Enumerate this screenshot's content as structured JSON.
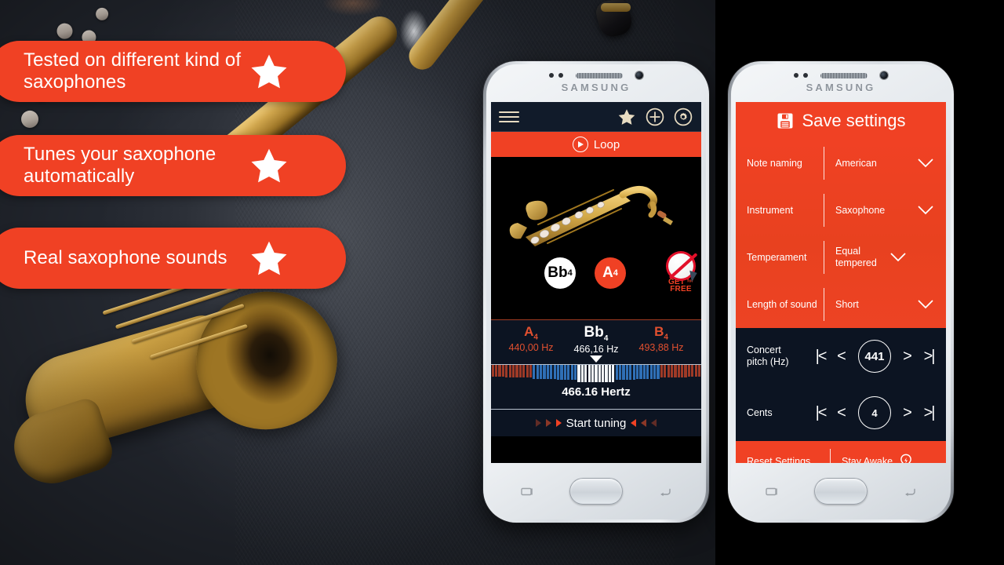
{
  "brand": {
    "name": "SAMSUNG"
  },
  "theme": {
    "accent": "#f04124",
    "app_dark": "#0c1422",
    "header_dark": "#111b2a",
    "icon_cream": "#e8dcc2",
    "white": "#ffffff"
  },
  "features": [
    {
      "text": "Tested on different kind of saxophones",
      "icon": "star-icon"
    },
    {
      "text": "Tunes your saxophone automatically",
      "icon": "star-icon"
    },
    {
      "text": "Real saxophone sounds",
      "icon": "star-icon"
    }
  ],
  "phone_tuner": {
    "header": {
      "menu_icon": "hamburger-icon",
      "favorite_icon": "star-icon",
      "add_icon": "plus-circle-icon",
      "settings_icon": "gear-icon"
    },
    "loop_button": {
      "label": "Loop",
      "icon": "play-circle-icon"
    },
    "instrument_image": "saxophone-illustration",
    "note_chips": [
      {
        "note": "Bb",
        "octave": "4",
        "style": "white"
      },
      {
        "note": "A",
        "octave": "4",
        "style": "orange"
      }
    ],
    "promo_badge": {
      "line1": "GET",
      "middle": "for",
      "line2": "FREE",
      "icon": "no-ads-icon"
    },
    "frequencies": [
      {
        "note": "A",
        "octave": "4",
        "hz": "440,00 Hz",
        "active": false
      },
      {
        "note": "Bb",
        "octave": "4",
        "hz": "466,16 Hz",
        "active": true
      },
      {
        "note": "B",
        "octave": "4",
        "hz": "493,88 Hz",
        "active": false
      }
    ],
    "readout": "466.16 Hertz",
    "start_tuning": {
      "label": "Start tuning"
    }
  },
  "phone_settings": {
    "header": {
      "title": "Save settings",
      "icon": "floppy-disk-icon"
    },
    "rows": [
      {
        "label": "Note naming",
        "value": "American",
        "icon": "chevron-down-icon"
      },
      {
        "label": "Instrument",
        "value": "Saxophone",
        "icon": "chevron-down-icon"
      },
      {
        "label": "Temperament",
        "value": "Equal tempered",
        "icon": "chevron-down-icon"
      },
      {
        "label": "Length of sound",
        "value": "Short",
        "icon": "chevron-down-icon"
      }
    ],
    "steppers": [
      {
        "label": "Concert pitch (Hz)",
        "value": "441",
        "first": "|<",
        "prev": "<",
        "next": ">",
        "last": ">|"
      },
      {
        "label": "Cents",
        "value": "4",
        "first": "|<",
        "prev": "<",
        "next": ">",
        "last": ">|"
      }
    ],
    "footer": {
      "reset_label": "Reset Settings",
      "stay_awake_label": "Stay Awake",
      "stay_awake_icon": "lightbulb-icon"
    }
  }
}
